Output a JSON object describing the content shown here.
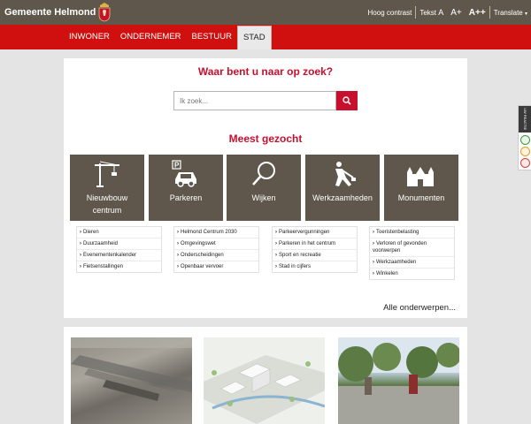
{
  "header": {
    "brand": "Gemeente Helmond",
    "tools": {
      "high_contrast": "Hoog contrast",
      "text_label": "Tekst",
      "size_a": "A",
      "size_a_plus": "A+",
      "size_a_plus_plus": "A++",
      "translate": "Translate"
    }
  },
  "nav": {
    "items": [
      "INWONER",
      "ONDERNEMER",
      "BESTUUR",
      "STAD"
    ],
    "active": "STAD"
  },
  "main": {
    "question": "Waar bent u naar op zoek?",
    "search": {
      "placeholder": "Ik zoek..."
    },
    "popular_title": "Meest gezocht",
    "tiles": [
      "Nieuwbouw centrum",
      "Parkeren",
      "Wijken",
      "Werkzaamheden",
      "Monumenten"
    ],
    "lists": [
      [
        "Dieren",
        "Duurzaamheid",
        "Evenementenkalender",
        "Fietsenstallingen"
      ],
      [
        "Helmond Centrum 2030",
        "Omgevingswet",
        "Onderscheidingen",
        "Openbaar vervoer"
      ],
      [
        "Parkeervergunningen",
        "Parkeren in het centrum",
        "Sport en recreatie",
        "Stad in cijfers"
      ],
      [
        "Toeristenbelasting",
        "Verloren of gevonden voorwerpen",
        "Werkzaamheden",
        "Winkelen"
      ]
    ],
    "all_subjects": "Alle onderwerpen..."
  },
  "feedback": {
    "label": "UW REACTIE"
  },
  "colors": {
    "brand_red": "#c8102e",
    "nav_red": "#d00f0f",
    "tile_brown": "#5f574b"
  }
}
